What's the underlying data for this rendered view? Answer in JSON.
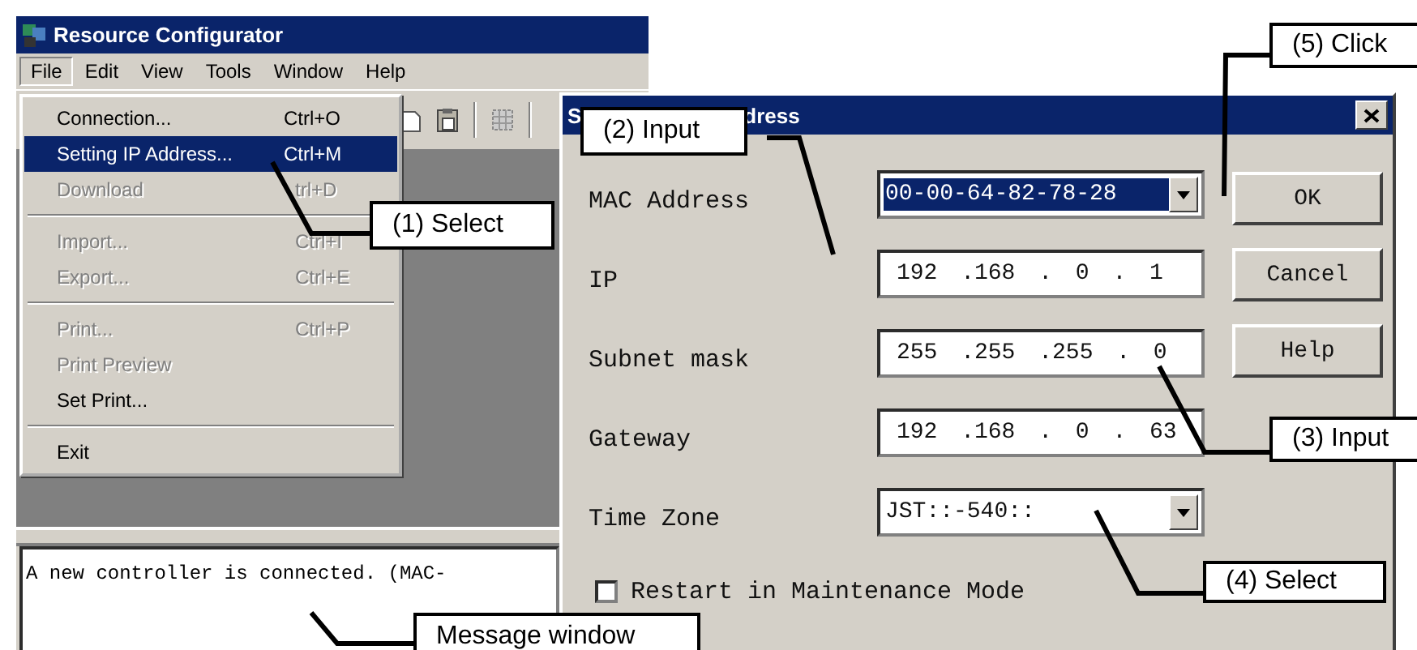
{
  "main_window": {
    "title": "Resource Configurator",
    "menu_bar": [
      {
        "label": "File",
        "selected": true
      },
      {
        "label": "Edit",
        "selected": false
      },
      {
        "label": "View",
        "selected": false
      },
      {
        "label": "Tools",
        "selected": false
      },
      {
        "label": "Window",
        "selected": false
      },
      {
        "label": "Help",
        "selected": false
      }
    ],
    "file_menu": [
      {
        "kind": "item",
        "label": "Connection...",
        "shortcut": "Ctrl+O",
        "disabled": false,
        "selected": false
      },
      {
        "kind": "item",
        "label": "Setting IP Address...",
        "shortcut": "Ctrl+M",
        "disabled": false,
        "selected": true
      },
      {
        "kind": "item",
        "label": "Download",
        "shortcut": "trl+D",
        "disabled": true,
        "selected": false
      },
      {
        "kind": "separator"
      },
      {
        "kind": "item",
        "label": "Import...",
        "shortcut": "Ctrl+I",
        "disabled": true,
        "selected": false
      },
      {
        "kind": "item",
        "label": "Export...",
        "shortcut": "Ctrl+E",
        "disabled": true,
        "selected": false
      },
      {
        "kind": "separator"
      },
      {
        "kind": "item",
        "label": "Print...",
        "shortcut": "Ctrl+P",
        "disabled": true,
        "selected": false
      },
      {
        "kind": "item",
        "label": "Print Preview",
        "disabled": true,
        "selected": false
      },
      {
        "kind": "item",
        "label": "Set Print...",
        "disabled": false,
        "selected": false
      },
      {
        "kind": "separator"
      },
      {
        "kind": "item",
        "label": "Exit",
        "disabled": false,
        "selected": false
      }
    ],
    "message_window": {
      "text": "A new controller is connected. (MAC-"
    }
  },
  "dialog": {
    "title_start": "S",
    "title_end": "dress",
    "fields": [
      {
        "kind": "combo",
        "label": "MAC Address",
        "value": "00-00-64-82-78-28",
        "focused": true
      },
      {
        "kind": "ip",
        "label": "IP",
        "value": "192 .168 . 0 . 1"
      },
      {
        "kind": "ip",
        "label": "Subnet mask",
        "value": "255 .255 .255 . 0"
      },
      {
        "kind": "ip",
        "label": "Gateway",
        "value": "192 .168 . 0 . 63"
      },
      {
        "kind": "combo",
        "label": "Time Zone",
        "value": "JST::-540::",
        "focused": false
      }
    ],
    "checkbox": {
      "label": "Restart in Maintenance Mode",
      "checked": false
    },
    "buttons": [
      "OK",
      "Cancel",
      "Help"
    ]
  },
  "callouts": [
    {
      "label": "(1) Select"
    },
    {
      "label": "(2) Input"
    },
    {
      "label": "(3) Input"
    },
    {
      "label": "(4) Select"
    },
    {
      "label": "(5) Click"
    },
    {
      "label": "Message window"
    }
  ]
}
